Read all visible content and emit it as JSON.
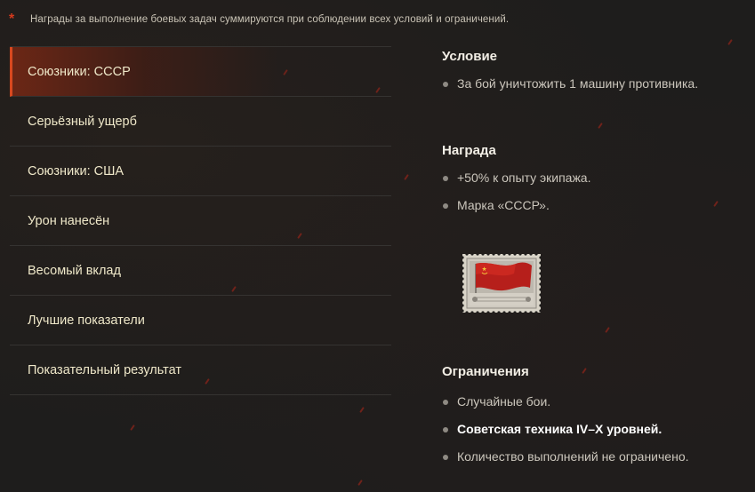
{
  "note": {
    "asterisk": "*",
    "text": "Награды за выполнение боевых задач суммируются при соблюдении всех условий и ограничений."
  },
  "menu": {
    "items": [
      {
        "label": "Союзники: СССР",
        "active": true
      },
      {
        "label": "Серьёзный ущерб",
        "active": false
      },
      {
        "label": "Союзники: США",
        "active": false
      },
      {
        "label": "Урон нанесён",
        "active": false
      },
      {
        "label": "Весомый вклад",
        "active": false
      },
      {
        "label": "Лучшие показатели",
        "active": false
      },
      {
        "label": "Показательный результат",
        "active": false
      }
    ]
  },
  "condition": {
    "title": "Условие",
    "items": [
      "За бой уничтожить 1 машину противника."
    ]
  },
  "reward": {
    "title": "Награда",
    "items": [
      "+50% к опыту экипажа.",
      "Марка «СССР»."
    ],
    "stamp_icon": "ussr-flag-stamp-icon"
  },
  "restrictions": {
    "title": "Ограничения",
    "items": [
      {
        "text": "Случайные бои.",
        "strong": false
      },
      {
        "text": "Советская техника IV–X уровней.",
        "strong": true
      },
      {
        "text": "Количество выполнений не ограничено.",
        "strong": false
      }
    ]
  },
  "colors": {
    "accent": "#d8481f",
    "background": "#1e1d1c",
    "menu_text": "#efe8c9",
    "body_text": "#cbc6bc"
  }
}
